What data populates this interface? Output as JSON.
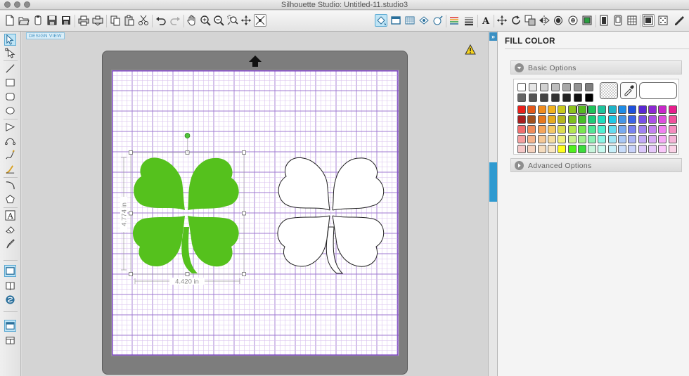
{
  "window": {
    "title": "Silhouette Studio: Untitled-11.studio3"
  },
  "toolbar": {
    "left_icons": [
      "new-document-icon",
      "open-icon",
      "open-library-icon",
      "save-icon",
      "save-selection-icon",
      "print-icon",
      "send-to-silhouette-icon",
      "copy-icon",
      "paste-icon",
      "cut-icon",
      "undo-icon",
      "redo-icon",
      "pan-icon",
      "zoom-in-icon",
      "zoom-out-icon",
      "zoom-select-icon",
      "zoom-drag-icon",
      "fit-to-page-icon"
    ],
    "right_icons": [
      "fill-color-icon",
      "line-color-icon",
      "fill-pattern-icon",
      "fill-gradient-icon",
      "line-style-icon",
      "text-style-icon",
      "text-icon",
      "transform-icon",
      "rotate-icon",
      "modify-icon",
      "mirror-icon",
      "offset-icon",
      "trace-icon",
      "replicate-icon",
      "page-setup-icon",
      "library-icon",
      "grid-icon",
      "cut-settings-icon",
      "registration-marks-icon",
      "send-icon"
    ]
  },
  "left_tools": [
    "select-icon",
    "point-edit-icon",
    "line-icon",
    "rectangle-icon",
    "rounded-rectangle-icon",
    "ellipse-icon",
    "polygon-icon",
    "curve-icon",
    "freehand-icon",
    "smooth-freehand-icon",
    "arc-icon",
    "regular-polygon-icon",
    "text-tool-icon",
    "eraser-icon",
    "knife-icon",
    "design-view-icon",
    "library-view-icon",
    "store-icon",
    "page-view-icon",
    "split-view-icon"
  ],
  "workspace": {
    "design_view_label": "DESIGN VIEW",
    "width_dimension": "4.420 in",
    "height_dimension": "4.774 in"
  },
  "panel": {
    "title": "FILL COLOR",
    "basic_options_label": "Basic Options",
    "advanced_options_label": "Advanced Options",
    "selected_color": "#55b91e",
    "grays": [
      "#ffffff",
      "#e6e6e6",
      "#d2d2d2",
      "#bdbdbd",
      "#a8a8a8",
      "#939393",
      "#7e7e7e",
      "#666666",
      "#555555",
      "#444444",
      "#333333",
      "#222222",
      "#111111",
      "#000000"
    ],
    "color_rows": [
      [
        "#e8201b",
        "#e2581a",
        "#f08c1e",
        "#f2b21e",
        "#c8c81c",
        "#8dc21e",
        "#55b91e",
        "#1ec25a",
        "#1ec39c",
        "#1eb4c8",
        "#1e8ce6",
        "#1e50dc",
        "#5a28d2",
        "#8c28d2",
        "#c828c8",
        "#e61e8c"
      ],
      [
        "#a81e1e",
        "#a0501e",
        "#e6781e",
        "#e6aa1e",
        "#b4b41e",
        "#7dbe1e",
        "#46be28",
        "#1ecb78",
        "#1edcbe",
        "#1ec8e6",
        "#4696e6",
        "#3c64e6",
        "#7850e6",
        "#aa50e6",
        "#dc50dc",
        "#f0509b"
      ],
      [
        "#f06e6e",
        "#f08c5a",
        "#f5a55a",
        "#f5c864",
        "#dcdc50",
        "#b4e650",
        "#78e650",
        "#50e696",
        "#50f0d2",
        "#64dcf0",
        "#78aaf0",
        "#7882f0",
        "#a082f0",
        "#c382f0",
        "#f082f0",
        "#f58cbe"
      ],
      [
        "#f5a0a0",
        "#f5b48c",
        "#f5c896",
        "#f5dca0",
        "#f0f07d",
        "#c8f08c",
        "#a0f08c",
        "#8cf0b4",
        "#8cf5e6",
        "#a0e6f5",
        "#aac8f5",
        "#aab4f5",
        "#c3aaf5",
        "#d7aaf5",
        "#f5aaf5",
        "#f5b4d7"
      ],
      [
        "#f5c8c8",
        "#f5d2be",
        "#f5dcbe",
        "#fae6c3",
        "#ffff1e",
        "#50f01e",
        "#3cdc3c",
        "#c8f5dc",
        "#c8faf0",
        "#c8f0fa",
        "#c8dcfa",
        "#c8d2fa",
        "#dcc8fa",
        "#e6c8fa",
        "#fac8fa",
        "#fad2e6"
      ]
    ]
  },
  "canvas": {
    "green_shape_color": "#55c11d",
    "white_shape_color": "#ffffff",
    "grid_minor_color": "#d9c2ee",
    "grid_major_color": "#9f79d0"
  }
}
